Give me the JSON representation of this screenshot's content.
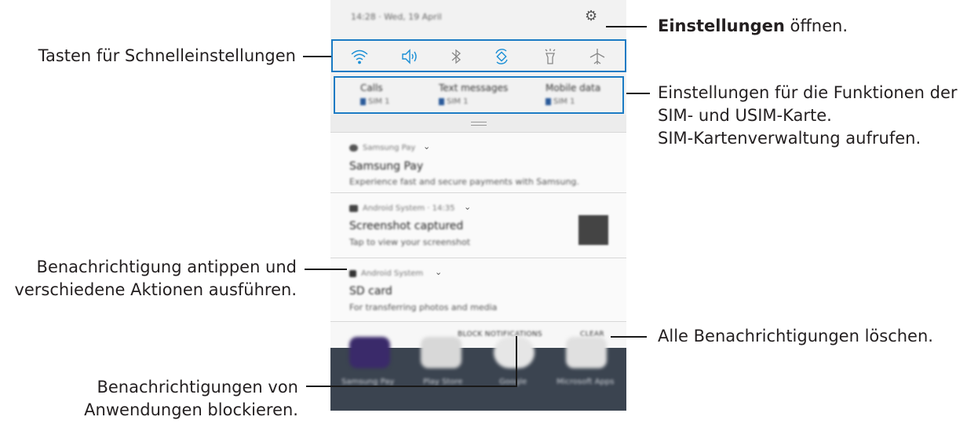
{
  "callouts": {
    "settings_bold": "Einstellungen",
    "settings_rest": " öffnen.",
    "quick_settings": "Tasten für Schnelleinstellungen",
    "sim_line1": "Einstellungen für die Funktionen der",
    "sim_line2": "SIM- und USIM-Karte.",
    "sim_line3": "SIM-Kartenverwaltung aufrufen.",
    "tap_line1": "Benachrichtigung antippen und",
    "tap_line2": "verschiedene Aktionen ausführen.",
    "clear_all": "Alle Benachrichtigungen löschen.",
    "block_line1": "Benachrichtigungen von",
    "block_line2": "Anwendungen blockieren."
  },
  "phone": {
    "status_time_date": "14:28 · Wed, 19 April",
    "quick_icons": [
      "wifi-icon",
      "sound-icon",
      "bluetooth-icon",
      "auto-rotate-icon",
      "flashlight-icon",
      "airplane-mode-icon"
    ],
    "sim": [
      {
        "title": "Calls",
        "sim": "SIM 1"
      },
      {
        "title": "Text messages",
        "sim": "SIM 1"
      },
      {
        "title": "Mobile data",
        "sim": "SIM 1"
      }
    ],
    "notifications": [
      {
        "app": "Samsung Pay",
        "title": "Samsung Pay",
        "text": "Experience fast and secure payments with Samsung."
      },
      {
        "app": "Android System · 14:35",
        "title": "Screenshot captured",
        "text": "Tap to view your screenshot"
      },
      {
        "app": "Android System",
        "title": "SD card",
        "text": "For transferring photos and media"
      }
    ],
    "actions": {
      "block": "BLOCK NOTIFICATIONS",
      "clear": "CLEAR"
    },
    "home_apps": [
      "Samsung Pay",
      "Play Store",
      "Google",
      "Microsoft Apps"
    ]
  },
  "colors": {
    "highlight": "#1b7bc4",
    "accent_icon": "#1b8fd6"
  }
}
